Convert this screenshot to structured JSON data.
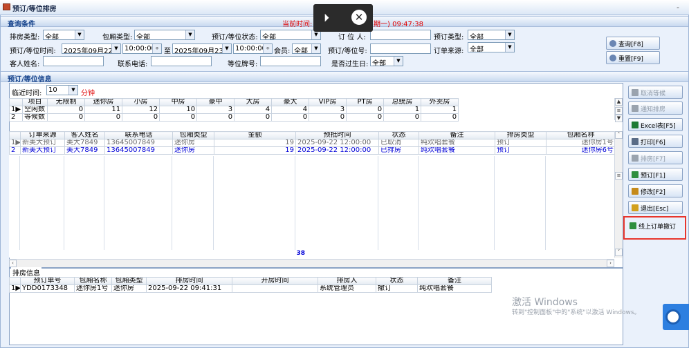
{
  "window": {
    "title": "预订/等位排房",
    "minimize": "-"
  },
  "overlay": {
    "icon_a": "⏵",
    "icon_b": "✕"
  },
  "query": {
    "header": "查询条件",
    "current_time_label": "当前时间:",
    "current_time_value": "期一) 09:47:38",
    "fields": {
      "room_arrange_type_label": "排房类型:",
      "room_arrange_type_value": "全部",
      "room_type_label": "包厢类型:",
      "room_type_value": "全部",
      "wait_status_label": "预订/等位状态:",
      "wait_status_value": "全部",
      "booker_label": "订 位 人:",
      "booker_value": "",
      "booking_type_label": "预订类型:",
      "booking_type_value": "全部",
      "time_label": "预订/等位时间:",
      "date_from": "2025年09月22日",
      "time_from": "10:00:00",
      "to_label": "至",
      "date_to": "2025年09月23日",
      "time_to": "10:00:00",
      "member_label": "会员:",
      "member_value": "全部",
      "booking_no_label": "预订/等位号:",
      "booking_no_value": "",
      "order_source_label": "订单来源:",
      "order_source_value": "全部",
      "guest_name_label": "客人姓名:",
      "guest_name_value": "",
      "phone_label": "联系电话:",
      "phone_value": "",
      "wait_card_label": "等位牌号:",
      "wait_card_value": "",
      "birthday_label": "是否过生日:",
      "birthday_value": "全部"
    },
    "search_button": "查询[F8]",
    "reset_button": "重置[F9]"
  },
  "info": {
    "header": "预订/等位信息",
    "recent_time_label": "临近时间:",
    "recent_time_value": "10",
    "recent_time_unit": "分钟"
  },
  "stats": {
    "headers": [
      "项目",
      "无限制",
      "迷你房",
      "小房",
      "中房",
      "豪中",
      "大房",
      "豪大",
      "VIP房",
      "PT房",
      "总统房",
      "外卖房"
    ],
    "rows": [
      {
        "marker": "1▶",
        "cells": [
          "空闲数",
          "0",
          "11",
          "12",
          "10",
          "3",
          "4",
          "4",
          "3",
          "0",
          "1",
          "1"
        ]
      },
      {
        "marker": "2",
        "cells": [
          "等候数",
          "0",
          "0",
          "0",
          "0",
          "0",
          "0",
          "0",
          "0",
          "0",
          "0",
          "0"
        ]
      }
    ]
  },
  "orders": {
    "headers": [
      "订单来源",
      "客人姓名",
      "联系电话",
      "包厢类型",
      "金额",
      "预抵时间",
      "状态",
      "备注",
      "排房类型",
      "包厢名称"
    ],
    "rows": [
      {
        "marker": "1▶",
        "style": "gray",
        "cells": [
          "新美大预订",
          "美大7849",
          "13645007849",
          "迷你房",
          "19",
          "2025-09-22 12:00:00",
          "已取消",
          "纯欢唱套餐",
          "预订",
          "迷你房1号"
        ]
      },
      {
        "marker": "2",
        "style": "blue",
        "cells": [
          "新美大预订",
          "美大7849",
          "13645007849",
          "迷你房",
          "19",
          "2025-09-22 12:00:00",
          "已排房",
          "纯欢唱套餐",
          "预订",
          "迷你房6号"
        ]
      }
    ],
    "total_amount": "38"
  },
  "arrange": {
    "header": "排房信息",
    "headers": [
      "预订单号",
      "包厢名称",
      "包厢类型",
      "排房时间",
      "开房时间",
      "排房人",
      "状态",
      "备注"
    ],
    "rows": [
      {
        "marker": "1▶",
        "cells": [
          "YDD0173348",
          "迷你房1号",
          "迷你房",
          "2025-09-22 09:41:31",
          "",
          "系统管理员",
          "撤订",
          "纯欢唱套餐"
        ]
      }
    ]
  },
  "side_buttons": [
    {
      "name": "cancel-wait-button",
      "label": "取消等候",
      "disabled": true,
      "color": "#9aa3ae"
    },
    {
      "name": "notify-arrange-button",
      "label": "通知排房",
      "disabled": true,
      "color": "#9aa3ae"
    },
    {
      "name": "excel-button",
      "label": "Excel表[F5]",
      "disabled": false,
      "color": "#1e7b34"
    },
    {
      "name": "print-button",
      "label": "打印[F6]",
      "disabled": false,
      "color": "#5a6c87"
    },
    {
      "name": "arrange-button",
      "label": "排房[F7]",
      "disabled": true,
      "color": "#9aa3ae"
    },
    {
      "name": "book-button",
      "label": "预订[F1]",
      "disabled": false,
      "color": "#2f8f3e"
    },
    {
      "name": "modify-button",
      "label": "修改[F2]",
      "disabled": false,
      "color": "#c58a1a"
    },
    {
      "name": "exit-button",
      "label": "退出[Esc]",
      "disabled": false,
      "color": "#d2a01c"
    },
    {
      "name": "cancel-online-order-button",
      "label": "线上订单撤订",
      "disabled": false,
      "color": "#2f8f3e"
    }
  ],
  "highlight_color": "#e8352c",
  "watermark": {
    "title": "激活 Windows",
    "subtitle": "转到\"控制面板\"中的\"系统\"以激活 Windows。"
  }
}
